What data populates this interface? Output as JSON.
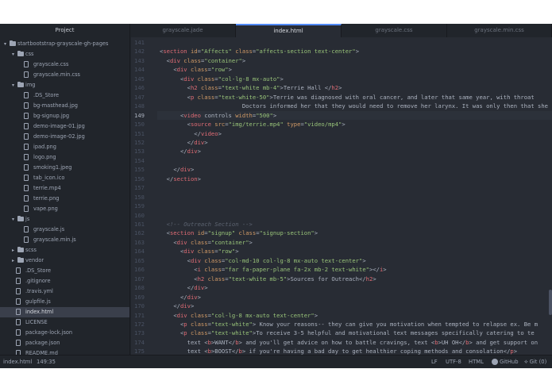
{
  "tabs": [
    {
      "label": "Project"
    },
    {
      "label": "grayscale.jade"
    },
    {
      "label": "index.html"
    },
    {
      "label": "grayscale.css"
    },
    {
      "label": "grayscale.min.css"
    }
  ],
  "tree": [
    {
      "label": "startbootstrap-grayscale-gh-pages",
      "kind": "folder",
      "depth": 0,
      "open": true
    },
    {
      "label": "css",
      "kind": "folder",
      "depth": 1,
      "open": true
    },
    {
      "label": "grayscale.css",
      "kind": "file",
      "depth": 2
    },
    {
      "label": "grayscale.min.css",
      "kind": "file",
      "depth": 2
    },
    {
      "label": "img",
      "kind": "folder",
      "depth": 1,
      "open": true
    },
    {
      "label": ".DS_Store",
      "kind": "file",
      "depth": 2
    },
    {
      "label": "bg-masthead.jpg",
      "kind": "file",
      "depth": 2
    },
    {
      "label": "bg-signup.jpg",
      "kind": "file",
      "depth": 2
    },
    {
      "label": "demo-image-01.jpg",
      "kind": "file",
      "depth": 2
    },
    {
      "label": "demo-image-02.jpg",
      "kind": "file",
      "depth": 2
    },
    {
      "label": "ipad.png",
      "kind": "file",
      "depth": 2
    },
    {
      "label": "logo.png",
      "kind": "file",
      "depth": 2
    },
    {
      "label": "smoking1.jpeg",
      "kind": "file",
      "depth": 2
    },
    {
      "label": "tab_icon.ico",
      "kind": "file",
      "depth": 2
    },
    {
      "label": "terrie.mp4",
      "kind": "file",
      "depth": 2
    },
    {
      "label": "terrie.png",
      "kind": "file",
      "depth": 2
    },
    {
      "label": "vape.png",
      "kind": "file",
      "depth": 2
    },
    {
      "label": "js",
      "kind": "folder",
      "depth": 1,
      "open": true
    },
    {
      "label": "grayscale.js",
      "kind": "file",
      "depth": 2
    },
    {
      "label": "grayscale.min.js",
      "kind": "file",
      "depth": 2
    },
    {
      "label": "scss",
      "kind": "folder",
      "depth": 1,
      "open": false
    },
    {
      "label": "vendor",
      "kind": "folder",
      "depth": 1,
      "open": false
    },
    {
      "label": ".DS_Store",
      "kind": "file",
      "depth": 1
    },
    {
      "label": ".gitignore",
      "kind": "file",
      "depth": 1
    },
    {
      "label": ".travis.yml",
      "kind": "file",
      "depth": 1
    },
    {
      "label": "gulpfile.js",
      "kind": "file",
      "depth": 1
    },
    {
      "label": "index.html",
      "kind": "file",
      "depth": 1,
      "selected": true
    },
    {
      "label": "LICENSE",
      "kind": "file",
      "depth": 1
    },
    {
      "label": "package-lock.json",
      "kind": "file",
      "depth": 1
    },
    {
      "label": "package.json",
      "kind": "file",
      "depth": 1
    },
    {
      "label": "README.md",
      "kind": "file",
      "depth": 1
    }
  ],
  "editor": {
    "current_line": 149,
    "lines": [
      {
        "n": 141,
        "code": ""
      },
      {
        "n": 142,
        "code": "<section id=\"Affects\" class=\"affects-section text-center\">"
      },
      {
        "n": 143,
        "code": "  <div class=\"container\">"
      },
      {
        "n": 144,
        "code": "    <div class=\"row\">"
      },
      {
        "n": 145,
        "code": "      <div class=\"col-lg-8 mx-auto\">"
      },
      {
        "n": 146,
        "code": "        <h2 class=\"text-white mb-4\">Terrie Hall </h2>"
      },
      {
        "n": 147,
        "code": "        <p class=\"text-white-50\">Terrie was diagnosed with oral cancer, and later that same year, with throat"
      },
      {
        "n": 148,
        "code": "                        Doctors informed her that they would need to remove her larynx. It was only then that she"
      },
      {
        "n": 149,
        "code": "      <video controls width=\"500\">"
      },
      {
        "n": 150,
        "code": "        <source src=\"img/terrie.mp4\" type=\"video/mp4\">"
      },
      {
        "n": 151,
        "code": "          </video>"
      },
      {
        "n": 152,
        "code": "        </div>"
      },
      {
        "n": 153,
        "code": "      </div>"
      },
      {
        "n": 154,
        "code": ""
      },
      {
        "n": 155,
        "code": "    </div>"
      },
      {
        "n": 156,
        "code": "  </section>"
      },
      {
        "n": 157,
        "code": ""
      },
      {
        "n": 158,
        "code": ""
      },
      {
        "n": 159,
        "code": ""
      },
      {
        "n": 160,
        "code": ""
      },
      {
        "n": 161,
        "code": "  <!-- Outreach Section -->"
      },
      {
        "n": 162,
        "code": "  <section id=\"signup\" class=\"signup-section\">"
      },
      {
        "n": 163,
        "code": "    <div class=\"container\">"
      },
      {
        "n": 164,
        "code": "      <div class=\"row\">"
      },
      {
        "n": 165,
        "code": "        <div class=\"col-md-10 col-lg-8 mx-auto text-center\">"
      },
      {
        "n": 166,
        "code": "          <i class=\"far fa-paper-plane fa-2x mb-2 text-white\"></i>"
      },
      {
        "n": 167,
        "code": "          <h2 class=\"text-white mb-5\">Sources for Outreach</h2>"
      },
      {
        "n": 168,
        "code": "        </div>"
      },
      {
        "n": 169,
        "code": "      </div>"
      },
      {
        "n": 170,
        "code": "    </div>"
      },
      {
        "n": 171,
        "code": "    <div class=\"col-lg-8 mx-auto text-center\">"
      },
      {
        "n": 172,
        "code": "      <p class=\"text-white\"> Know your reasons-- they can give you motivation when tempted to relapse ex. Be m"
      },
      {
        "n": 173,
        "code": "      <p class=\"text-white\">To receive 3-5 helpful and motivational text messages specifically catering to te"
      },
      {
        "n": 174,
        "code": "        text <b>WANT</b> and you'll get advice on how to battle cravings, text <b>UH OH</b> and get support on"
      },
      {
        "n": 175,
        "code": "        text <b>BOOST</b> if you're having a bad day to get healthier coping methods and consolation</p>"
      }
    ]
  },
  "status": {
    "file": "index.html",
    "position": "149:35",
    "line_ending": "LF",
    "encoding": "UTF-8",
    "grammar": "HTML",
    "github": "GitHub",
    "git": "Git (0)"
  },
  "colors": {
    "tag": "#e06c75",
    "attr": "#d19a66",
    "string": "#98c379",
    "comment": "#5c6370",
    "text": "#abb2bf"
  }
}
